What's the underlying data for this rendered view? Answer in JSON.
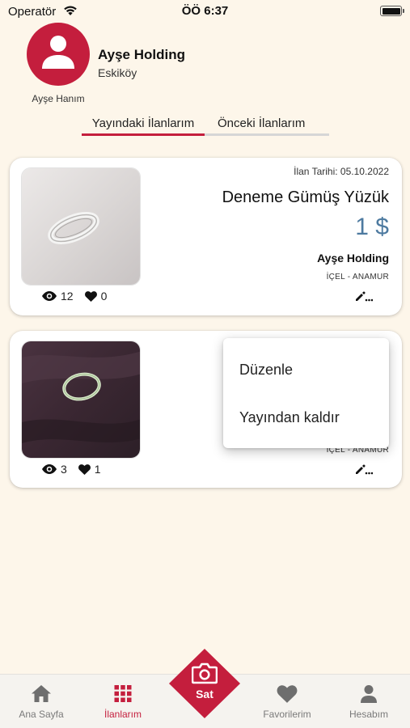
{
  "status_bar": {
    "carrier": "Operatör",
    "time": "ÖÖ 6:37"
  },
  "profile": {
    "name": "Ayşe Holding",
    "subtitle": "Eskiköy",
    "avatar_caption": "Ayşe Hanım"
  },
  "tabs": [
    {
      "label": "Yayındaki İlanlarım",
      "active": true
    },
    {
      "label": "Önceki İlanlarım",
      "active": false
    }
  ],
  "listings": [
    {
      "date_label": "İlan Tarihi: 05.10.2022",
      "title": "Deneme Gümüş Yüzük",
      "price": "1 $",
      "seller": "Ayşe Holding",
      "location": "İÇEL - ANAMUR",
      "views": "12",
      "likes": "0"
    },
    {
      "location": "İÇEL - ANAMUR",
      "views": "3",
      "likes": "1"
    }
  ],
  "popup_menu": {
    "items": [
      "Düzenle",
      "Yayından kaldır"
    ]
  },
  "bottom_nav": {
    "items": [
      {
        "label": "Ana Sayfa",
        "icon": "home-icon"
      },
      {
        "label": "İlanlarım",
        "icon": "grid-icon",
        "active": true
      },
      {
        "label": "Favorilerim",
        "icon": "heart-icon"
      },
      {
        "label": "Hesabım",
        "icon": "person-icon"
      }
    ],
    "center": {
      "label": "Sat",
      "icon": "camera-icon"
    }
  },
  "colors": {
    "accent": "#c41e3d",
    "background": "#fdf6ea",
    "price": "#4d7aa0"
  }
}
